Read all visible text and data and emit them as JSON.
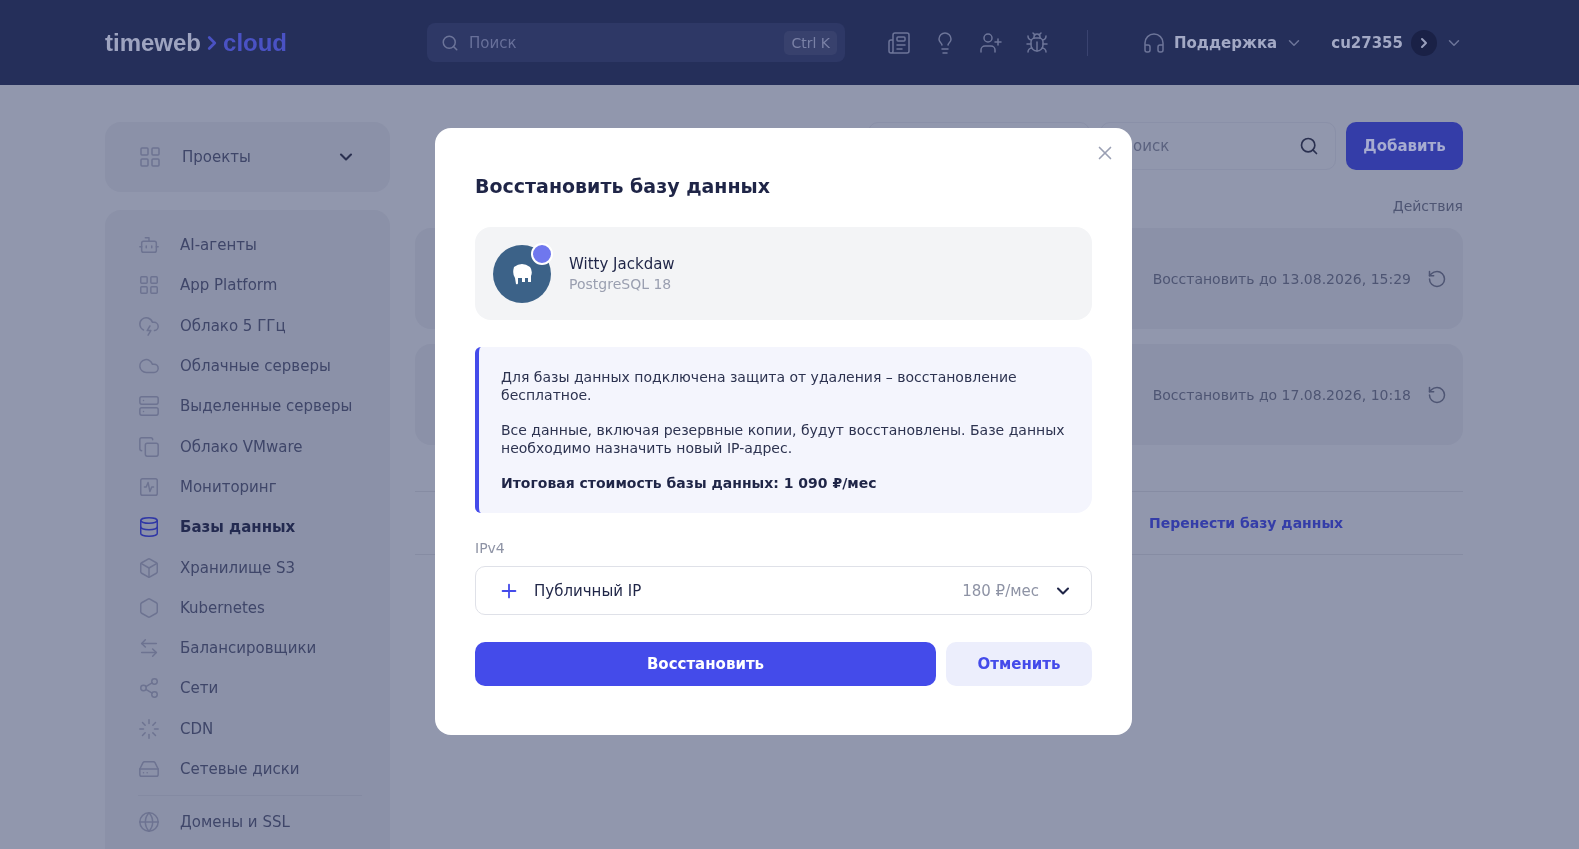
{
  "header": {
    "logo": {
      "name": "timeweb",
      "accent": "cloud"
    },
    "search": {
      "placeholder": "Поиск",
      "shortcut": "Ctrl K"
    },
    "support": "Поддержка",
    "account": "cu27355"
  },
  "sidebar": {
    "projects": "Проекты",
    "items": [
      {
        "label": "AI-агенты",
        "selected": false
      },
      {
        "label": "App Platform",
        "selected": false
      },
      {
        "label": "Облако 5 ГГц",
        "selected": false
      },
      {
        "label": "Облачные серверы",
        "selected": false
      },
      {
        "label": "Выделенные серверы",
        "selected": false
      },
      {
        "label": "Облако VMware",
        "selected": false
      },
      {
        "label": "Мониторинг",
        "selected": false
      },
      {
        "label": "Базы данных",
        "selected": true
      },
      {
        "label": "Хранилище S3",
        "selected": false
      },
      {
        "label": "Kubernetes",
        "selected": false
      },
      {
        "label": "Балансировщики",
        "selected": false
      },
      {
        "label": "Сети",
        "selected": false
      },
      {
        "label": "CDN",
        "selected": false
      },
      {
        "label": "Сетевые диски",
        "selected": false
      }
    ],
    "footer_items": [
      {
        "label": "Домены и SSL",
        "selected": false
      }
    ]
  },
  "main": {
    "search": {
      "placeholder": "оиск"
    },
    "add_button": "Добавить",
    "column": "Действия",
    "rows": [
      {
        "action": "Восстановить до 13.08.2026, 15:29"
      },
      {
        "action": "Восстановить до 17.08.2026, 10:18"
      }
    ],
    "link": "Перенести базу данных"
  },
  "modal": {
    "title": "Восстановить базу данных",
    "database": {
      "name": "Witty Jackdaw",
      "engine": "PostgreSQL 18"
    },
    "notice": {
      "paragraphs": [
        "Для базы данных подключена защита от удаления – восстановление бесплатное.",
        "Все данные, включая резервные копии, будут восстановлены. Базе данных необходимо назначить новый IP-адрес."
      ],
      "total": "Итоговая стоимость базы данных: 1 090 ₽/мес"
    },
    "ipv4": {
      "label": "IPv4",
      "option": "Публичный IP",
      "price": "180 ₽/мес"
    },
    "buttons": {
      "confirm": "Восстановить",
      "cancel": "Отменить"
    }
  }
}
